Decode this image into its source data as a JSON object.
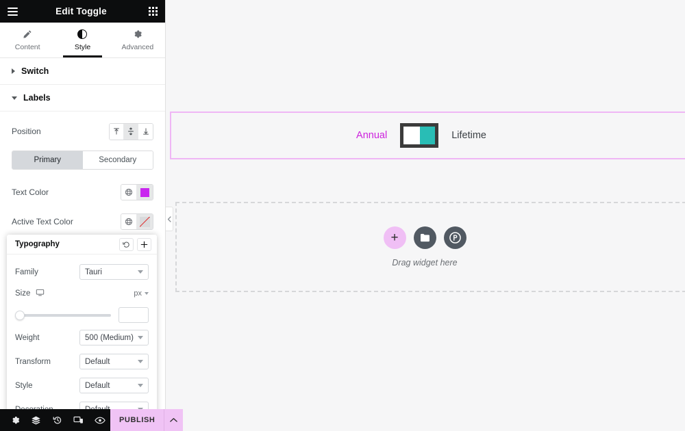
{
  "panel": {
    "title": "Edit Toggle",
    "menu_icon": "hamburger-icon",
    "apps_icon": "grid-apps-icon",
    "tabs": [
      {
        "label": "Content",
        "icon": "pencil-icon",
        "active": false
      },
      {
        "label": "Style",
        "icon": "half-circle-contrast-icon",
        "active": true
      },
      {
        "label": "Advanced",
        "icon": "gear-icon",
        "active": false
      }
    ],
    "sections": [
      {
        "label": "Switch",
        "expanded": false
      },
      {
        "label": "Labels",
        "expanded": true
      }
    ],
    "labels_section": {
      "position": {
        "label": "Position",
        "options": [
          "align-top",
          "align-middle",
          "align-bottom"
        ],
        "selected": "align-middle"
      },
      "segmented": {
        "options": [
          "Primary",
          "Secondary"
        ],
        "selected": "Primary"
      },
      "controls": [
        {
          "label": "Text Color",
          "value_type": "color",
          "color": "#c926ef"
        },
        {
          "label": "Active Text Color",
          "value_type": "none"
        },
        {
          "label": "Typography",
          "value_type": "edit",
          "icon": "pencil-icon"
        }
      ],
      "globe_icon": "globe-icon"
    }
  },
  "typography_popover": {
    "title": "Typography",
    "reset_icon": "reset-icon",
    "add_icon": "plus-icon",
    "fields": [
      {
        "label": "Family",
        "value": "Tauri",
        "type": "select"
      },
      {
        "label": "Weight",
        "value": "500 (Medium)",
        "type": "select"
      },
      {
        "label": "Transform",
        "value": "Default",
        "type": "select"
      },
      {
        "label": "Style",
        "value": "Default",
        "type": "select"
      },
      {
        "label": "Decoration",
        "value": "Default",
        "type": "select"
      }
    ],
    "size": {
      "label": "Size",
      "device_icon": "desktop-icon",
      "unit": "px",
      "value": "",
      "slider_percent": 0
    }
  },
  "bottom_bar": {
    "icons": [
      {
        "name": "settings-gear-icon"
      },
      {
        "name": "navigator-layers-icon"
      },
      {
        "name": "history-icon"
      },
      {
        "name": "responsive-mode-icon"
      },
      {
        "name": "preview-eye-icon"
      }
    ],
    "publish": {
      "label": "PUBLISH",
      "arrow_icon": "chevron-up-icon",
      "color": "#f0c3f5"
    }
  },
  "canvas": {
    "section_border_color": "#efb6f5",
    "toggle_widget": {
      "primary_label": "Annual",
      "primary_color": "#cc22dd",
      "secondary_label": "Lifetime",
      "secondary_color": "#3b4045",
      "switch_color": "#29bdb5",
      "switch_border_color": "#3b3b3b",
      "state": "off"
    },
    "dropzone": {
      "text": "Drag widget here",
      "buttons": [
        {
          "name": "add-element-button",
          "icon": "plus-icon",
          "color": "#f0bff5"
        },
        {
          "name": "add-template-button",
          "icon": "folder-icon",
          "color": "#515962"
        },
        {
          "name": "add-pro-widget-button",
          "icon": "elementor-pro-icon",
          "color": "#515962"
        }
      ]
    }
  },
  "collapse_handle": {
    "icon": "chevron-left-icon"
  }
}
